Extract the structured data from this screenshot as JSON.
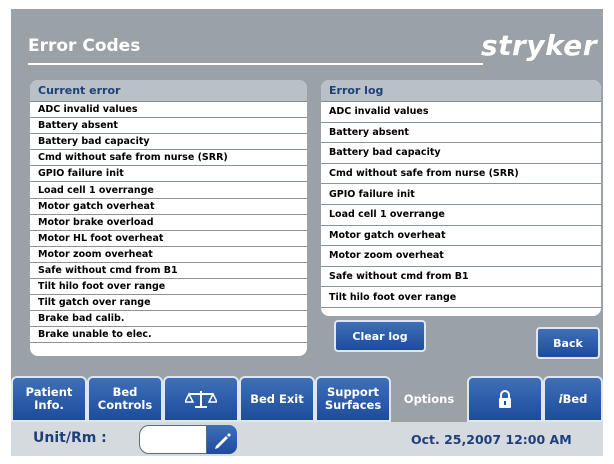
{
  "header": {
    "title": "Error Codes",
    "brand": "stryker"
  },
  "current_error": {
    "title": "Current error",
    "items": [
      "ADC invalid values",
      "Battery absent",
      "Battery bad capacity",
      "Cmd without safe from nurse (SRR)",
      "GPIO failure init",
      "Load cell 1 overrange",
      "Motor gatch overheat",
      "Motor brake overload",
      "Motor HL foot overheat",
      "Motor zoom overheat",
      "Safe without cmd from B1",
      "Tilt hilo foot over range",
      "Tilt gatch over range",
      "Brake bad calib.",
      "Brake unable to elec."
    ]
  },
  "error_log": {
    "title": "Error log",
    "items": [
      "ADC invalid values",
      "Battery absent",
      "Battery bad capacity",
      "Cmd without safe from nurse (SRR)",
      "GPIO failure init",
      "Load cell 1 overrange",
      "Motor gatch overheat",
      "Motor zoom overheat",
      "Safe without cmd from B1",
      "Tilt hilo foot over range"
    ],
    "clear_label": "Clear log"
  },
  "back_label": "Back",
  "tabs": [
    {
      "label1": "Patient",
      "label2": "Info."
    },
    {
      "label1": "Bed",
      "label2": "Controls"
    },
    {
      "icon": "scale-icon"
    },
    {
      "label1": "Bed Exit",
      "label2": ""
    },
    {
      "label1": "Support",
      "label2": "Surfaces"
    },
    {
      "label1": "Options",
      "label2": ""
    },
    {
      "icon": "lock-icon"
    },
    {
      "label1": "Bed",
      "prefix": "i"
    }
  ],
  "footer": {
    "unit_label": "Unit/Rm :",
    "unit_value": "",
    "datetime": "Oct. 25,2007  12:00 AM"
  },
  "colors": {
    "accent": "#1d4c9c",
    "background": "#9aa2a8",
    "heading": "#1f3f7a"
  }
}
